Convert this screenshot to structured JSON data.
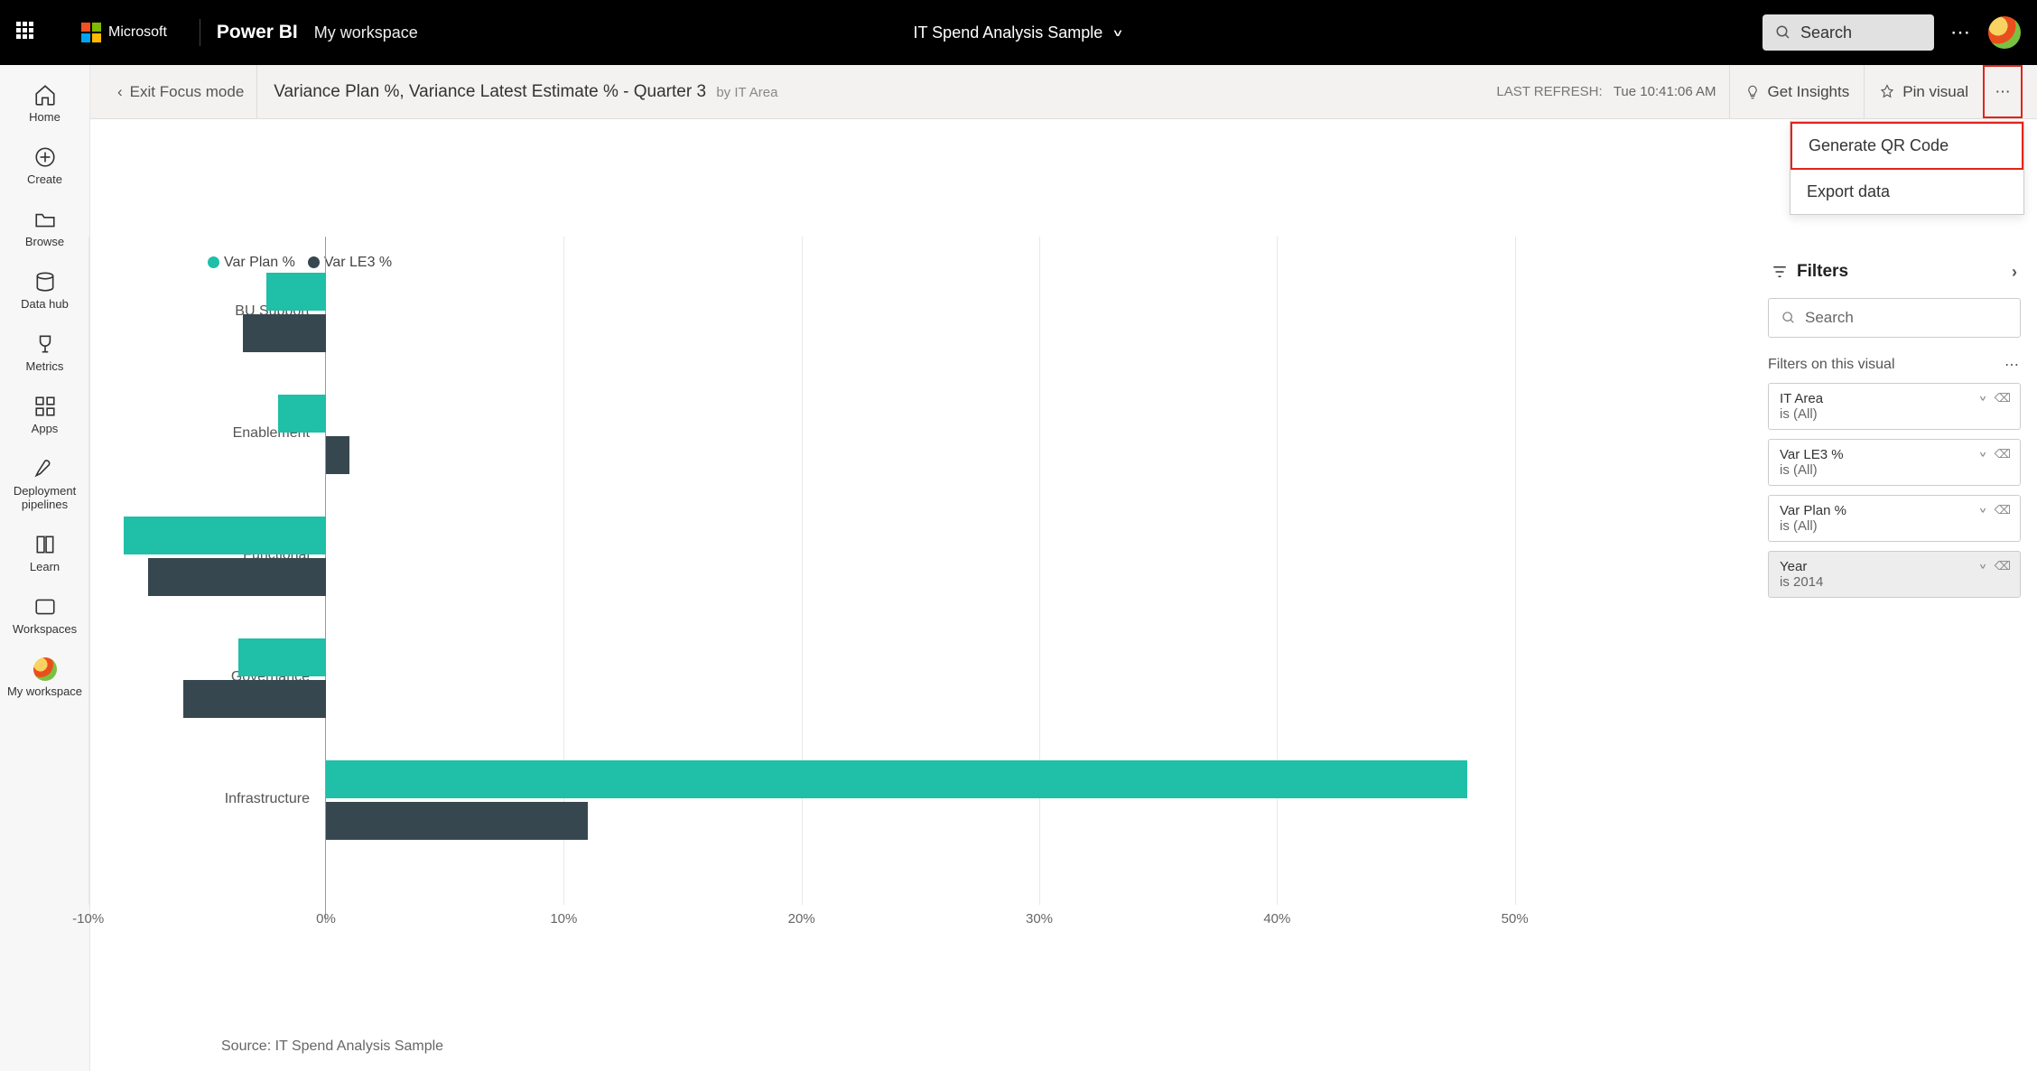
{
  "header": {
    "company": "Microsoft",
    "product": "Power BI",
    "workspace": "My workspace",
    "report_name": "IT Spend Analysis Sample",
    "search_placeholder": "Search"
  },
  "nav": {
    "items": [
      {
        "label": "Home"
      },
      {
        "label": "Create"
      },
      {
        "label": "Browse"
      },
      {
        "label": "Data hub"
      },
      {
        "label": "Metrics"
      },
      {
        "label": "Apps"
      },
      {
        "label": "Deployment pipelines"
      },
      {
        "label": "Learn"
      },
      {
        "label": "Workspaces"
      },
      {
        "label": "My workspace"
      }
    ]
  },
  "toolbar": {
    "exit": "Exit Focus mode",
    "title_main": "Variance Plan %, Variance Latest Estimate % - Quarter 3",
    "title_sub": "by IT Area",
    "last_refresh_label": "LAST REFRESH:",
    "last_refresh_value": "Tue 10:41:06 AM",
    "get_insights": "Get Insights",
    "pin_visual": "Pin visual"
  },
  "dropdown": {
    "generate_qr": "Generate QR Code",
    "export_data": "Export data"
  },
  "legend": {
    "series1": "Var Plan %",
    "series2": "Var LE3 %"
  },
  "source_text": "Source: IT Spend Analysis Sample",
  "filters": {
    "heading": "Filters",
    "search_placeholder": "Search",
    "section_label": "Filters on this visual",
    "cards": [
      {
        "name": "IT Area",
        "value": "is (All)",
        "active": false
      },
      {
        "name": "Var LE3 %",
        "value": "is (All)",
        "active": false
      },
      {
        "name": "Var Plan %",
        "value": "is (All)",
        "active": false
      },
      {
        "name": "Year",
        "value": "is 2014",
        "active": true
      }
    ]
  },
  "chart_data": {
    "type": "bar",
    "orientation": "horizontal",
    "title": "Variance Plan %, Variance Latest Estimate % - Quarter 3 by IT Area",
    "xlabel": "",
    "ylabel": "",
    "xlim": [
      -10,
      50
    ],
    "x_ticks": [
      "-10%",
      "0%",
      "10%",
      "20%",
      "30%",
      "40%",
      "50%"
    ],
    "categories": [
      "BU Support",
      "Enablement",
      "Functional",
      "Governance",
      "Infrastructure"
    ],
    "series": [
      {
        "name": "Var Plan %",
        "color": "#1fbfa8",
        "values": [
          -2.5,
          -2.0,
          -8.5,
          -3.7,
          48.0
        ]
      },
      {
        "name": "Var LE3 %",
        "color": "#37474f",
        "values": [
          -3.5,
          1.0,
          -7.5,
          -6.0,
          11.0
        ]
      }
    ]
  }
}
